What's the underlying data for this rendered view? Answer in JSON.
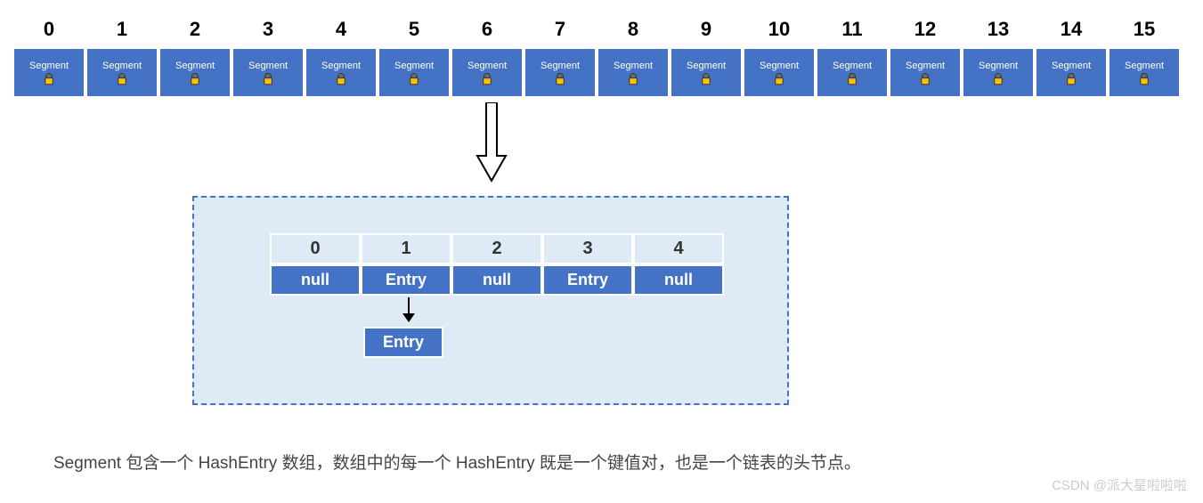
{
  "segments": {
    "count": 16,
    "label": "Segment",
    "indices": [
      "0",
      "1",
      "2",
      "3",
      "4",
      "5",
      "6",
      "7",
      "8",
      "9",
      "10",
      "11",
      "12",
      "13",
      "14",
      "15"
    ]
  },
  "detail": {
    "headers": [
      "0",
      "1",
      "2",
      "3",
      "4"
    ],
    "values": [
      "null",
      "Entry",
      "null",
      "Entry",
      "null"
    ],
    "linked": "Entry"
  },
  "caption": "Segment 包含一个 HashEntry 数组，数组中的每一个 HashEntry 既是一个键值对，也是一个链表的头节点。",
  "watermark": "CSDN @派大星啦啦啦",
  "chart_data": {
    "type": "diagram",
    "title": "ConcurrentHashMap Segment structure (JDK 1.7)",
    "segment_count": 16,
    "segment_label": "Segment",
    "segments_are_locked": true,
    "expanded_segment_index": 6,
    "hash_entry_array": {
      "length": 5,
      "slots": [
        {
          "index": 0,
          "value": "null"
        },
        {
          "index": 1,
          "value": "Entry",
          "chain": [
            "Entry"
          ]
        },
        {
          "index": 2,
          "value": "null"
        },
        {
          "index": 3,
          "value": "Entry"
        },
        {
          "index": 4,
          "value": "null"
        }
      ]
    },
    "annotation": "Segment 包含一个 HashEntry 数组，数组中的每一个 HashEntry 既是一个键值对，也是一个链表的头节点。"
  }
}
